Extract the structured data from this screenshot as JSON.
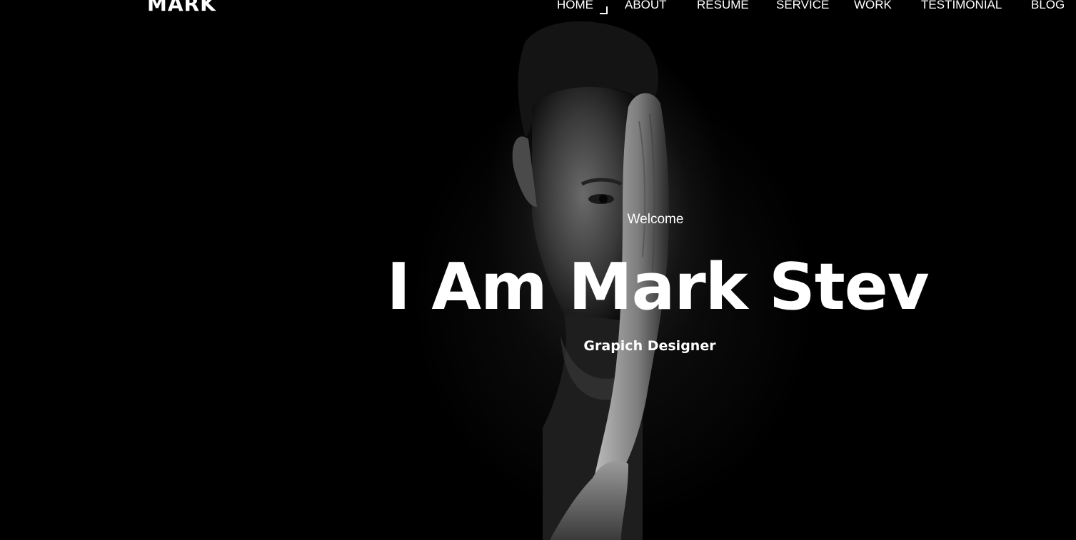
{
  "brand": {
    "logo": "MARK"
  },
  "nav": {
    "items": [
      {
        "label": "HOME",
        "active": true
      },
      {
        "label": "ABOUT"
      },
      {
        "label": "RESUME"
      },
      {
        "label": "SERVICE"
      },
      {
        "label": "WORK"
      },
      {
        "label": "TESTIMONIAL"
      },
      {
        "label": "BLOG"
      }
    ]
  },
  "hero": {
    "welcome": "Welcome",
    "headline": "I Am Mark Stev",
    "subtitle": "Grapich Designer",
    "background_color": "#000000",
    "text_color": "#ffffff"
  }
}
